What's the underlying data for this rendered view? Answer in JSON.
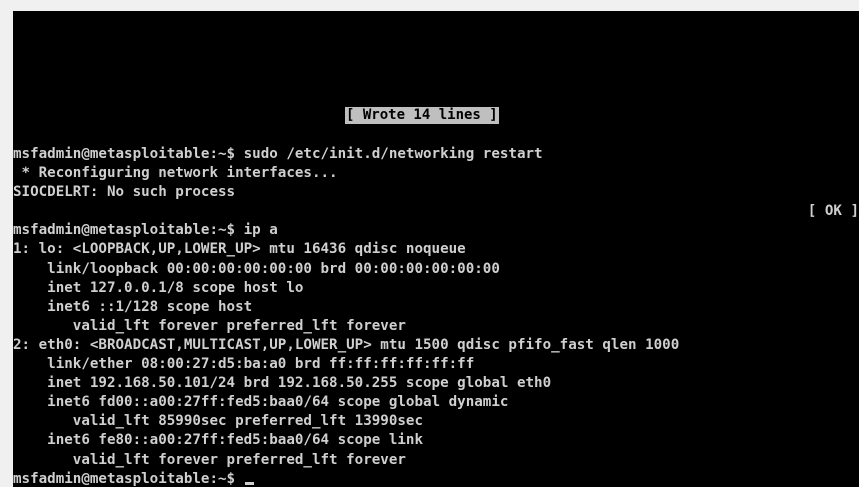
{
  "status_message": "[ Wrote 14 lines ]",
  "lines": [
    "msfadmin@metasploitable:~$ sudo /etc/init.d/networking restart",
    " * Reconfiguring network interfaces...",
    "SIOCDELRT: No such process",
    "[ OK ]",
    "msfadmin@metasploitable:~$ ip a",
    "1: lo: <LOOPBACK,UP,LOWER_UP> mtu 16436 qdisc noqueue",
    "    link/loopback 00:00:00:00:00:00 brd 00:00:00:00:00:00",
    "    inet 127.0.0.1/8 scope host lo",
    "    inet6 ::1/128 scope host",
    "       valid_lft forever preferred_lft forever",
    "2: eth0: <BROADCAST,MULTICAST,UP,LOWER_UP> mtu 1500 qdisc pfifo_fast qlen 1000",
    "    link/ether 08:00:27:d5:ba:a0 brd ff:ff:ff:ff:ff:ff",
    "    inet 192.168.50.101/24 brd 192.168.50.255 scope global eth0",
    "    inet6 fd00::a00:27ff:fed5:baa0/64 scope global dynamic",
    "       valid_lft 85990sec preferred_lft 13990sec",
    "    inet6 fe80::a00:27ff:fed5:baa0/64 scope link",
    "       valid_lft forever preferred_lft forever"
  ],
  "prompt": "msfadmin@metasploitable:~$ ",
  "colors": {
    "background": "#000000",
    "text": "#cfcfcf",
    "status_bg": "#bfbfbf",
    "frame": "#f0f0f0"
  }
}
